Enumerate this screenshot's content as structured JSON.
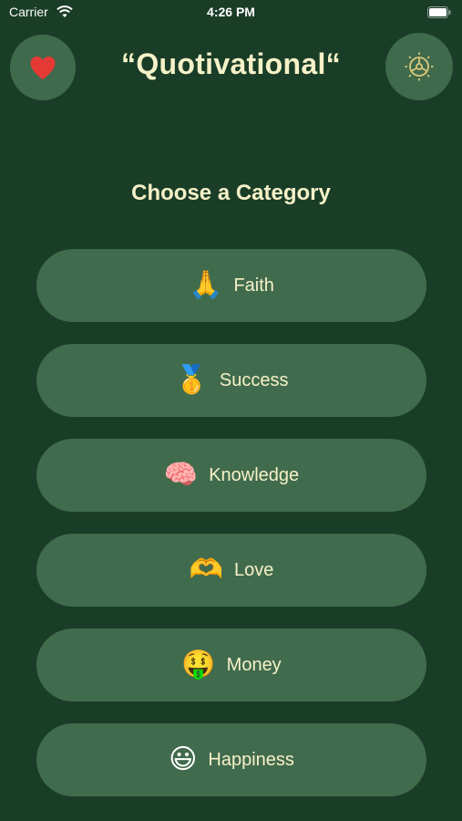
{
  "status_bar": {
    "carrier": "Carrier",
    "time": "4:26 PM"
  },
  "header": {
    "title": "“Quotivational“",
    "favorites_icon": "heart-icon",
    "settings_icon": "gear-icon"
  },
  "main": {
    "heading": "Choose a Category",
    "categories": [
      {
        "emoji": "🙏",
        "label": "Faith"
      },
      {
        "emoji": "🥇",
        "label": "Success"
      },
      {
        "emoji": "🧠",
        "label": "Knowledge"
      },
      {
        "emoji": "🫶",
        "label": "Love"
      },
      {
        "emoji": "🤑",
        "label": "Money"
      },
      {
        "emoji": "😃",
        "label": "Happiness"
      }
    ]
  },
  "colors": {
    "background": "#1a3d28",
    "button": "#416b4d",
    "text": "#f6f1c8",
    "heart": "#e53935"
  }
}
